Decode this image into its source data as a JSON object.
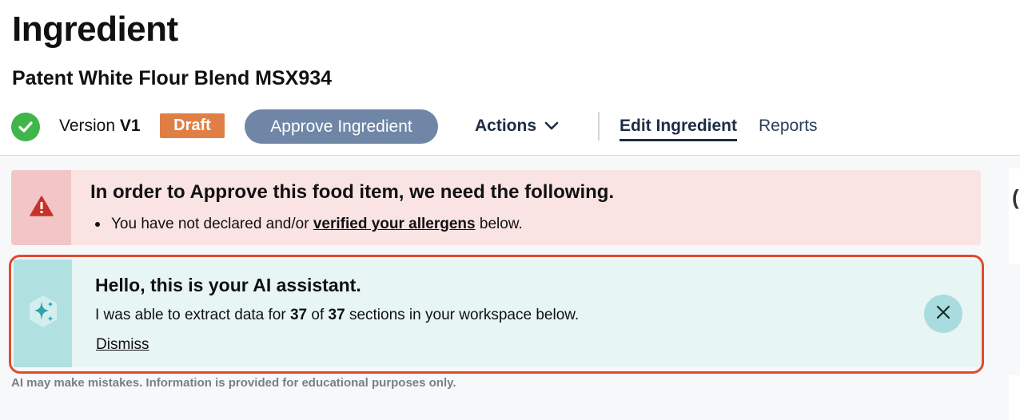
{
  "page": {
    "title": "Ingredient",
    "subtitle": "Patent White Flour Blend MSX934"
  },
  "status": {
    "check_icon": "check-circle-icon",
    "version_label": "Version",
    "version_value": "V1",
    "badge": "Draft",
    "approve_button": "Approve Ingredient",
    "actions_label": "Actions",
    "tabs": [
      {
        "label": "Edit Ingredient",
        "active": true
      },
      {
        "label": "Reports",
        "active": false
      }
    ]
  },
  "alert": {
    "icon": "warning-icon",
    "title": "In order to Approve this food item, we need the following.",
    "item_prefix": "You have not declared and/or",
    "item_link": "verified your allergens",
    "item_suffix": "below."
  },
  "ai": {
    "icon": "sparkles-icon",
    "title": "Hello, this is your AI assistant.",
    "text_prefix": "I was able to extract data for",
    "extracted": "37",
    "text_of": "of",
    "total": "37",
    "text_suffix": "sections in your workspace below.",
    "dismiss": "Dismiss",
    "close_icon": "close-icon"
  },
  "disclaimer": "AI may make mistakes. Information is provided for educational purposes only.",
  "right_edge_glyph": "(",
  "colors": {
    "success": "#3fb54a",
    "draft": "#e07f45",
    "approve": "#6f86a6",
    "alert_bg": "#fae3e3",
    "ai_bg": "#e7f5f4",
    "highlight": "#e34a2f"
  }
}
